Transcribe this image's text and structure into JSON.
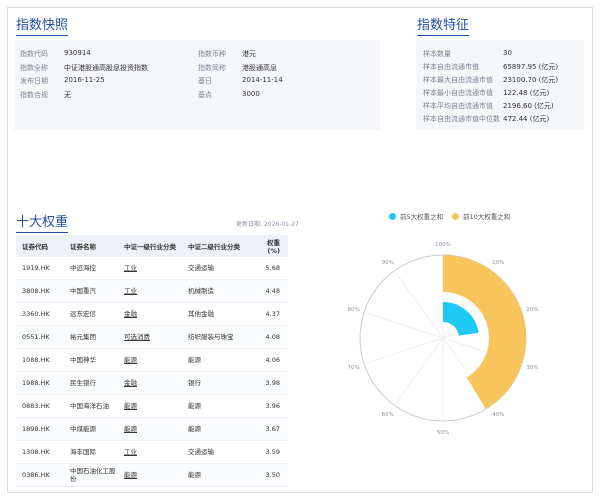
{
  "snapshot": {
    "title": "指数快照",
    "left": [
      {
        "label": "指数代码",
        "value": "930914"
      },
      {
        "label": "指数全称",
        "value": "中证港股通高股息投资指数"
      },
      {
        "label": "发布日期",
        "value": "2016-11-25"
      },
      {
        "label": "指数合规",
        "value": "无"
      }
    ],
    "right": [
      {
        "label": "指数币种",
        "value": "港元"
      },
      {
        "label": "指数简称",
        "value": "港股通高息"
      },
      {
        "label": "基日",
        "value": "2014-11-14"
      },
      {
        "label": "基点",
        "value": "3000"
      }
    ]
  },
  "features": {
    "title": "指数特征",
    "items": [
      {
        "label": "样本数量",
        "value": "30"
      },
      {
        "label": "样本自由流通市值",
        "value": "65897.95 (亿元)"
      },
      {
        "label": "样本最大自由流通市值",
        "value": "23100.70 (亿元)"
      },
      {
        "label": "样本最小自由流通市值",
        "value": "122.48 (亿元)"
      },
      {
        "label": "样本平均自由流通市值",
        "value": "2196.60 (亿元)"
      },
      {
        "label": "样本自由流通市值中位数",
        "value": "472.44 (亿元)"
      }
    ]
  },
  "top10": {
    "title": "十大权重",
    "updated": "更新日期: 2026-01-27",
    "columns": [
      "证券代码",
      "证券名称",
      "中证一级行业分类",
      "中证二级行业分类",
      "权重(%)"
    ],
    "rows": [
      [
        "1919.HK",
        "中远海控",
        "工业",
        "交通运输",
        "5.68"
      ],
      [
        "3808.HK",
        "中国重汽",
        "工业",
        "机械制造",
        "4.48"
      ],
      [
        "3360.HK",
        "远东宏信",
        "金融",
        "其他金融",
        "4.37"
      ],
      [
        "0551.HK",
        "裕元集团",
        "可选消费",
        "纺织服装与珠宝",
        "4.08"
      ],
      [
        "1088.HK",
        "中国神华",
        "能源",
        "能源",
        "4.06"
      ],
      [
        "1988.HK",
        "民生银行",
        "金融",
        "银行",
        "3.98"
      ],
      [
        "0883.HK",
        "中国海洋石油",
        "能源",
        "能源",
        "3.96"
      ],
      [
        "1898.HK",
        "中煤能源",
        "能源",
        "能源",
        "3.67"
      ],
      [
        "1308.HK",
        "海丰国际",
        "工业",
        "交通运输",
        "3.59"
      ],
      [
        "0386.HK",
        "中国石油化工股份",
        "能源",
        "能源",
        "3.50"
      ]
    ]
  },
  "chart_data": {
    "type": "pie",
    "series": [
      {
        "name": "前5大权重之和",
        "value": 22.67,
        "color": "#1ec9f5"
      },
      {
        "name": "前10大权重之和",
        "value": 41.37,
        "color": "#f8c55c"
      }
    ],
    "tick_labels": [
      "100%",
      "10%",
      "20%",
      "30%",
      "40%",
      "50%",
      "60%",
      "70%",
      "80%",
      "90%"
    ],
    "max": 100,
    "legend_position": "top"
  }
}
